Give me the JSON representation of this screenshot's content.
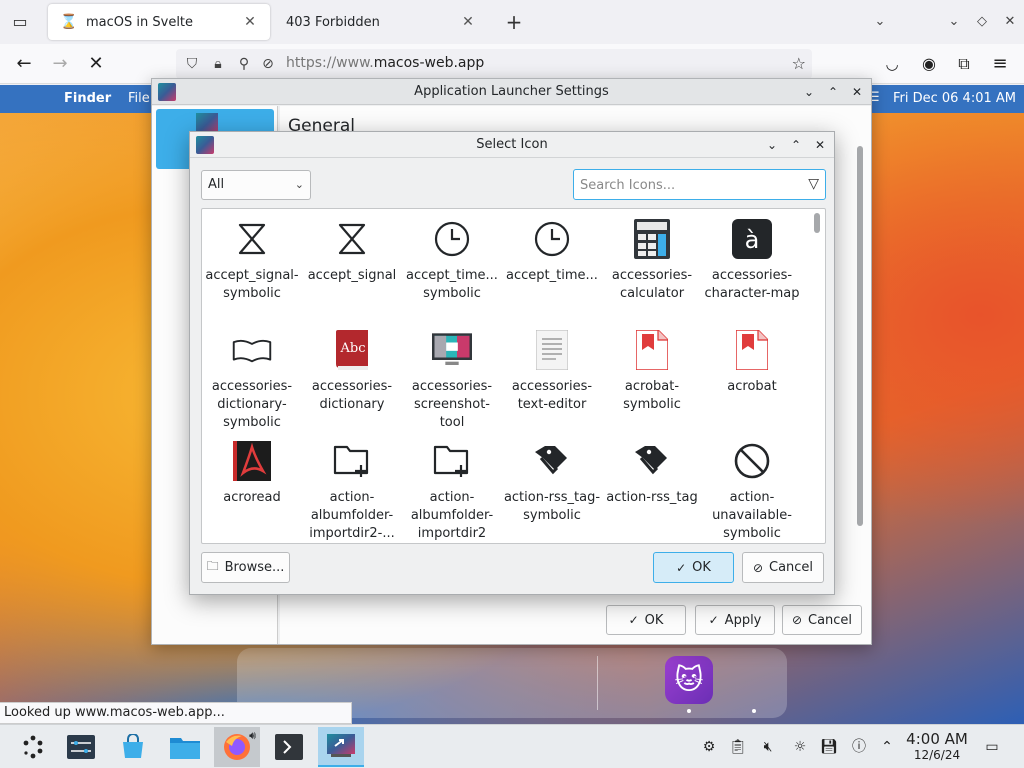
{
  "browser": {
    "tabs": [
      {
        "title": "macOS in Svelte",
        "active": true
      },
      {
        "title": "403 Forbidden",
        "active": false
      }
    ],
    "url_prefix": "https://www.",
    "url_domain": "macos-web.app",
    "status_text": "Looked up www.macos-web.app..."
  },
  "menubar": {
    "finder": "Finder",
    "file": "File",
    "datetime": "Fri Dec 06  4:01 AM"
  },
  "settings_window": {
    "title": "Application Launcher Settings",
    "section_title": "General",
    "ok_label": "OK",
    "apply_label": "Apply",
    "cancel_label": "Cancel"
  },
  "dialog": {
    "title": "Select Icon",
    "filter_value": "All",
    "search_placeholder": "Search Icons...",
    "browse_label": "Browse...",
    "ok_label": "OK",
    "cancel_label": "Cancel",
    "icons": [
      {
        "label": "accept_signal-symbolic",
        "icon": "sigma-outline-icon"
      },
      {
        "label": "accept_signal",
        "icon": "sigma-outline-icon"
      },
      {
        "label": "accept_time...\nsymbolic",
        "icon": "clock-icon"
      },
      {
        "label": "accept_time...",
        "icon": "clock-icon"
      },
      {
        "label": "accessories-calculator",
        "icon": "calculator-icon"
      },
      {
        "label": "accessories-character-map",
        "icon": "character-map-icon"
      },
      {
        "label": "accessories-dictionary-symbolic",
        "icon": "open-book-icon"
      },
      {
        "label": "accessories-dictionary",
        "icon": "dictionary-book-icon"
      },
      {
        "label": "accessories-screenshot-tool",
        "icon": "screenshot-monitor-icon"
      },
      {
        "label": "accessories-text-editor",
        "icon": "text-document-icon"
      },
      {
        "label": "acrobat-symbolic",
        "icon": "pdf-document-icon"
      },
      {
        "label": "acrobat",
        "icon": "pdf-document-icon"
      },
      {
        "label": "acroread",
        "icon": "acroread-icon"
      },
      {
        "label": "action-albumfolder-importdir2-...",
        "icon": "folder-add-icon"
      },
      {
        "label": "action-albumfolder-importdir2",
        "icon": "folder-add-icon"
      },
      {
        "label": "action-rss_tag-symbolic",
        "icon": "tags-icon"
      },
      {
        "label": "action-rss_tag",
        "icon": "tags-icon"
      },
      {
        "label": "action-unavailable-symbolic",
        "icon": "unavailable-icon"
      }
    ]
  },
  "taskbar": {
    "time": "4:00 AM",
    "date": "12/6/24"
  },
  "colors": {
    "accent": "#3daee9",
    "menubar": "#3572c0"
  }
}
